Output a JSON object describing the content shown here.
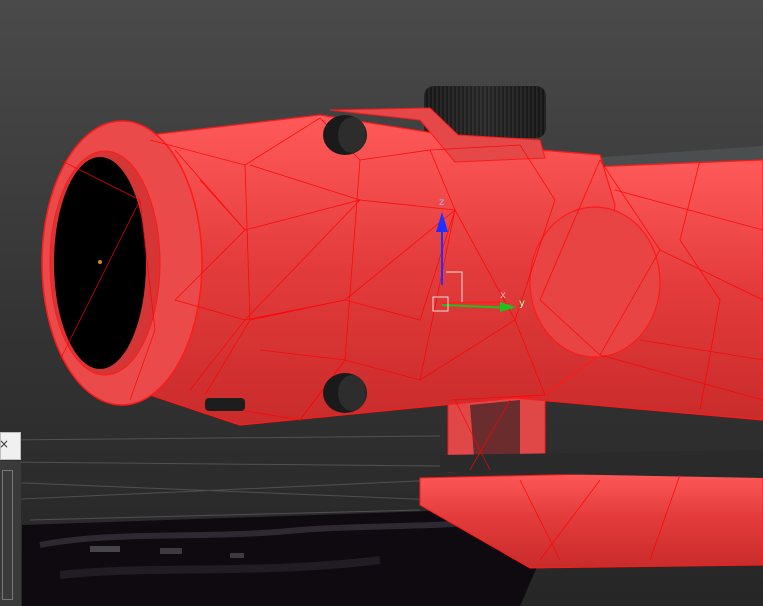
{
  "viewport": {
    "name": "3D viewport",
    "background": "#2b2b2b",
    "selection_color": "#e53a3a",
    "wire_color": "#ff0000"
  },
  "gizmo": {
    "x_label": "x",
    "y_label": "y",
    "z_label": "z",
    "x_color": "#ff2020",
    "y_color": "#20c020",
    "z_color": "#2030ff"
  },
  "panel": {
    "close_label": "×"
  }
}
